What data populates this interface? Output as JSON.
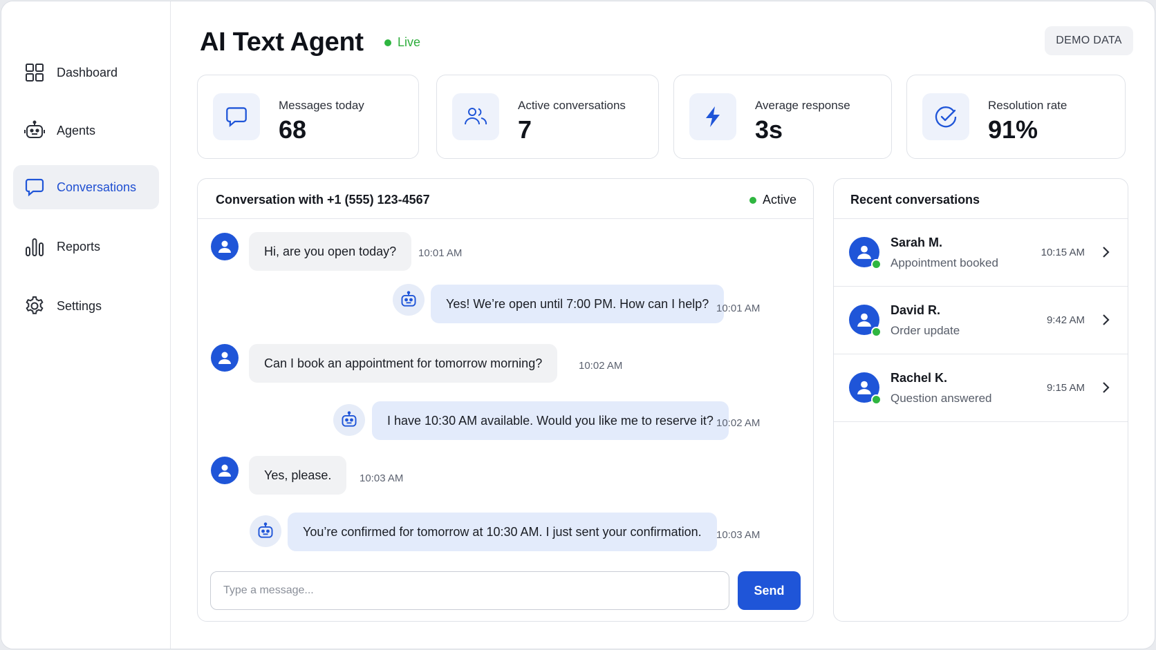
{
  "app": {
    "title": "AI Text Agent",
    "status": "Live",
    "badge": "DEMO DATA",
    "accent_color": "#1f55d8",
    "live_color": "#2fb640"
  },
  "sidebar": {
    "items": [
      {
        "label": "Dashboard",
        "icon": "dashboard-grid-icon",
        "active": false
      },
      {
        "label": "Agents",
        "icon": "robot-icon",
        "active": false
      },
      {
        "label": "Conversations",
        "icon": "chat-bubble-icon",
        "active": true
      },
      {
        "label": "Reports",
        "icon": "bar-chart-icon",
        "active": false
      },
      {
        "label": "Settings",
        "icon": "gear-icon",
        "active": false
      }
    ]
  },
  "stats": [
    {
      "label": "Messages today",
      "value": "68",
      "icon": "chat-bubble-icon"
    },
    {
      "label": "Active conversations",
      "value": "7",
      "icon": "users-icon"
    },
    {
      "label": "Average response",
      "value": "3s",
      "icon": "lightning-icon"
    },
    {
      "label": "Resolution rate",
      "value": "91%",
      "icon": "check-circle-icon"
    }
  ],
  "conversation": {
    "title": "Conversation with +1 (555) 123-4567",
    "status": "Active",
    "messages": [
      {
        "from": "user",
        "text": "Hi, are you open today?",
        "time": "10:01 AM"
      },
      {
        "from": "bot",
        "text": "Yes! We’re open until 7:00 PM. How can I help?",
        "time": "10:01 AM"
      },
      {
        "from": "user",
        "text": "Can I book an appointment for tomorrow morning?",
        "time": "10:02 AM"
      },
      {
        "from": "bot",
        "text": "I have 10:30 AM available. Would you like me to reserve it?",
        "time": "10:02 AM"
      },
      {
        "from": "user",
        "text": "Yes, please.",
        "time": "10:03 AM"
      },
      {
        "from": "bot",
        "text": "You’re confirmed for tomorrow at 10:30 AM. I just sent your confirmation.",
        "time": "10:03 AM"
      }
    ],
    "input_placeholder": "Type a message...",
    "send_label": "Send"
  },
  "recent": {
    "title": "Recent conversations",
    "items": [
      {
        "name": "Sarah M.",
        "summary": "Appointment booked",
        "time": "10:15 AM"
      },
      {
        "name": "David R.",
        "summary": "Order update",
        "time": "9:42 AM"
      },
      {
        "name": "Rachel K.",
        "summary": "Question answered",
        "time": "9:15 AM"
      }
    ]
  }
}
